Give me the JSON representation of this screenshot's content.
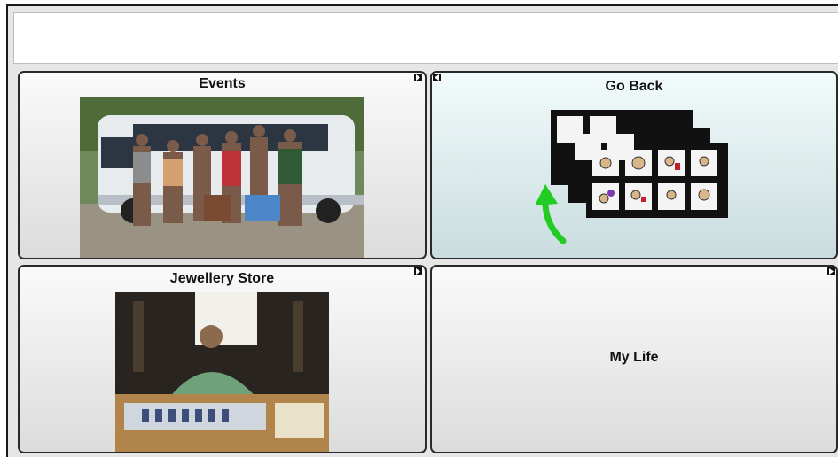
{
  "window": {
    "title": ""
  },
  "message_bar": {
    "text": ""
  },
  "buttons": [
    {
      "label": "Events",
      "has_link_icon": true
    },
    {
      "label": "Go Back",
      "has_back_icon": true
    },
    {
      "label": "Jewellery Store",
      "has_link_icon": true
    },
    {
      "label": "My Life",
      "has_link_icon": true
    }
  ],
  "colors": {
    "border": "#2a2a2a",
    "active_cell": "#c9dcde",
    "arrow": "#22cc22"
  },
  "icons": {
    "link": "triangle-right-icon",
    "back": "triangle-left-icon"
  }
}
